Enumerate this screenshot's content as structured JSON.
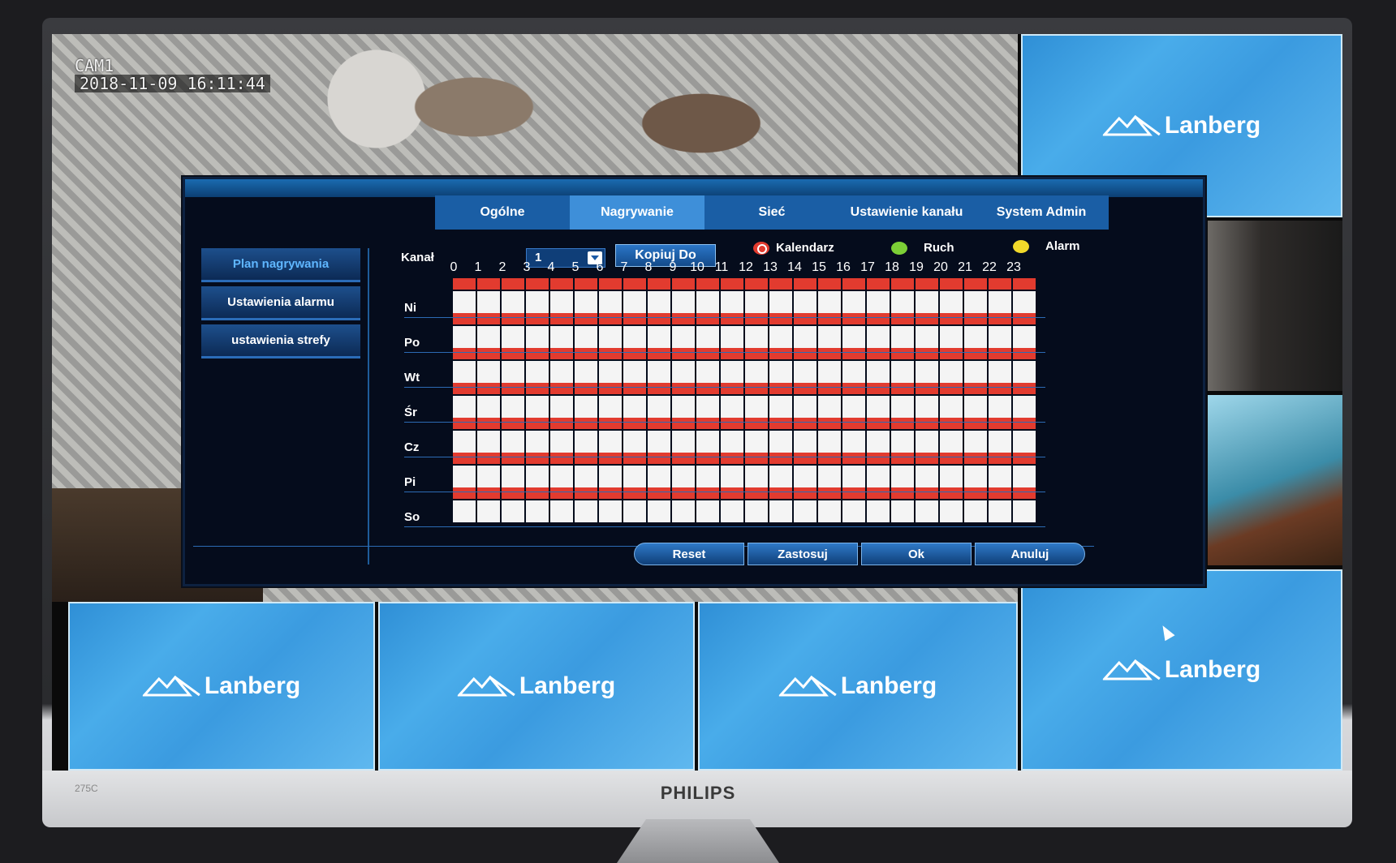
{
  "monitor": {
    "brand": "PHILIPS",
    "model": "275C"
  },
  "camera": {
    "name": "CAM1",
    "timestamp": "2018-11-09 16:11:44"
  },
  "logo_text": "Lanberg",
  "tabs": [
    {
      "label": "Ogólne"
    },
    {
      "label": "Nagrywanie",
      "active": true
    },
    {
      "label": "Sieć"
    },
    {
      "label": "Ustawienie kanału"
    },
    {
      "label": "System Admin"
    }
  ],
  "sidebar": [
    {
      "label": "Plan nagrywania",
      "active": true
    },
    {
      "label": "Ustawienia alarmu"
    },
    {
      "label": "ustawienia strefy"
    }
  ],
  "channel": {
    "label": "Kanał",
    "value": "1"
  },
  "copy_button": "Kopiuj Do",
  "legend": {
    "schedule": {
      "label": "Kalendarz",
      "color": "#e23b2f"
    },
    "motion": {
      "label": "Ruch",
      "color": "#7ccf36"
    },
    "alarm": {
      "label": "Alarm",
      "color": "#f1d92a"
    }
  },
  "hours": [
    "0",
    "1",
    "2",
    "3",
    "4",
    "5",
    "6",
    "7",
    "8",
    "9",
    "10",
    "11",
    "12",
    "13",
    "14",
    "15",
    "16",
    "17",
    "18",
    "19",
    "20",
    "21",
    "22",
    "23"
  ],
  "days": [
    "Ni",
    "Po",
    "Wt",
    "Śr",
    "Cz",
    "Pi",
    "So"
  ],
  "schedule_mode": "Kalendarz",
  "buttons": {
    "reset": "Reset",
    "apply": "Zastosuj",
    "ok": "Ok",
    "cancel": "Anuluj"
  }
}
